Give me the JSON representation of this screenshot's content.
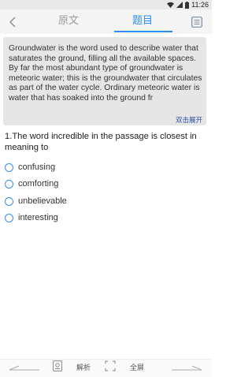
{
  "status": {
    "time": "11:26"
  },
  "nav": {
    "back_icon": "chevron-left-icon",
    "tabs": [
      {
        "label": "原文",
        "active": false
      },
      {
        "label": "题目",
        "active": true
      }
    ],
    "list_icon": "list-icon",
    "accent_color": "#2d8cf0"
  },
  "passage": {
    "text": "Groundwater is the word used to describe water that saturates the ground, filling all the available spaces. By far the most abundant type of groundwater is meteoric water; this is the groundwater that circulates as part of the water cycle. Ordinary meteoric water is water that has soaked into the ground fr",
    "expand_label": "双击展开"
  },
  "question": {
    "text": "1.The word incredible in the passage is closest in meaning to",
    "options": [
      "confusing",
      "comforting",
      "unbelievable",
      "interesting"
    ]
  },
  "toolbar": {
    "analysis_label": "解析",
    "fullscreen_label": "全屏"
  }
}
